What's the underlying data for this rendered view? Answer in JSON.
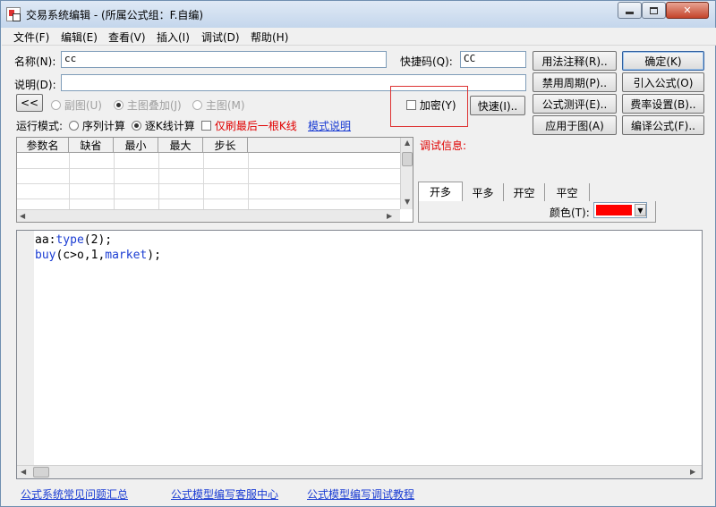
{
  "window": {
    "title": "交易系统编辑 - (所属公式组：F.自编)"
  },
  "menu": [
    "文件(F)",
    "编辑(E)",
    "查看(V)",
    "插入(I)",
    "调试(D)",
    "帮助(H)"
  ],
  "form": {
    "name_label": "名称(N):",
    "name_value": "cc",
    "shortcut_label": "快捷码(Q):",
    "shortcut_value": "CC",
    "desc_label": "说明(D):",
    "desc_value": ""
  },
  "buttons": {
    "usage_notes": "用法注释(R)..",
    "ok": "确定(K)",
    "disable_period": "禁用周期(P)..",
    "import_formula": "引入公式(O)",
    "formula_test": "公式测评(E)..",
    "fee_settings": "费率设置(B)..",
    "apply_chart": "应用于图(A)",
    "compile": "编译公式(F)..",
    "collapse": "<<",
    "quick": "快速(I).."
  },
  "chart_options": {
    "sub_chart": "副图(U)",
    "main_overlay": "主图叠加(J)",
    "main_chart": "主图(M)",
    "encrypt": "加密(Y)"
  },
  "run_mode": {
    "label": "运行模式:",
    "sequence": "序列计算",
    "per_bar": "逐K线计算",
    "last_bar_only": "仅刷最后一根K线",
    "mode_help": "模式说明"
  },
  "param_table": {
    "headers": [
      "参数名",
      "缺省",
      "最小",
      "最大",
      "步长"
    ]
  },
  "debug": {
    "label": "调试信息:"
  },
  "tabs": [
    "开多",
    "平多",
    "开空",
    "平空"
  ],
  "color": {
    "label": "颜色(T):",
    "value": "#ff0000"
  },
  "code": {
    "line1_name": "aa:",
    "line1_func": "type",
    "line1_rest": "(2);",
    "line2_func": "buy",
    "line2_rest_a": "(c>o,1,",
    "line2_kw": "market",
    "line2_rest_b": ");"
  },
  "footer_links": [
    "公式系统常见问题汇总",
    "公式模型编写客服中心",
    "公式模型编写调试教程"
  ]
}
